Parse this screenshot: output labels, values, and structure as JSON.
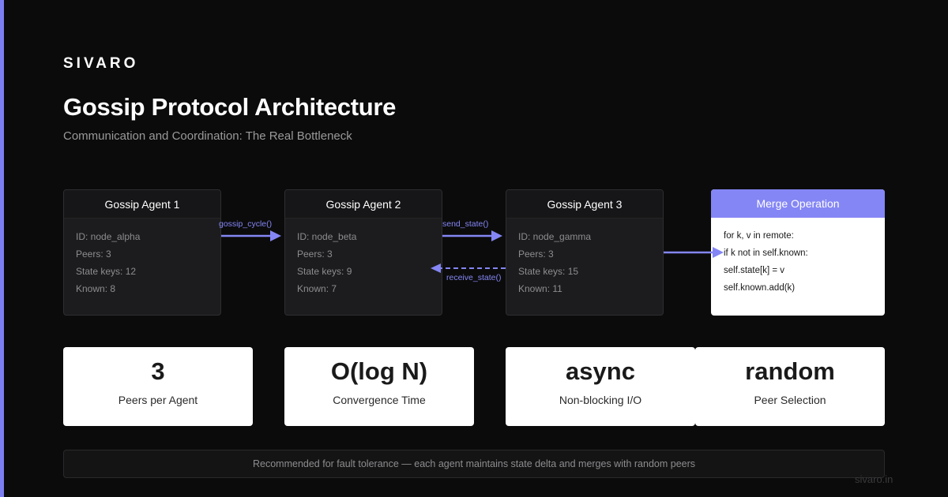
{
  "brand": "SIVARO",
  "title": "Gossip Protocol Architecture",
  "subtitle": "Communication and Coordination: The Real Bottleneck",
  "colors": {
    "accent": "#8486f5",
    "background": "#0b0b0b",
    "card": "#1c1c1e"
  },
  "agents": [
    {
      "title": "Gossip Agent 1",
      "id": "ID: node_alpha",
      "peers": "Peers: 3",
      "state_keys": "State keys: 12",
      "known": "Known: 8"
    },
    {
      "title": "Gossip Agent 2",
      "id": "ID: node_beta",
      "peers": "Peers: 3",
      "state_keys": "State keys: 9",
      "known": "Known: 7"
    },
    {
      "title": "Gossip Agent 3",
      "id": "ID: node_gamma",
      "peers": "Peers: 3",
      "state_keys": "State keys: 15",
      "known": "Known: 11"
    }
  ],
  "merge": {
    "title": "Merge Operation",
    "lines": [
      "for k, v in remote:",
      "if k not in self.known:",
      "self.state[k] = v",
      "self.known.add(k)"
    ]
  },
  "edges": {
    "gossip_cycle": "gossip_cycle()",
    "send_state": "send_state()",
    "receive_state": "receive_state()"
  },
  "stats": [
    {
      "value": "3",
      "label": "Peers per Agent"
    },
    {
      "value": "O(log N)",
      "label": "Convergence Time"
    },
    {
      "value": "async",
      "label": "Non-blocking I/O"
    },
    {
      "value": "random",
      "label": "Peer Selection"
    }
  ],
  "footer": "Recommended for fault tolerance — each agent maintains state delta and merges with random peers",
  "site": "sivaro.in"
}
